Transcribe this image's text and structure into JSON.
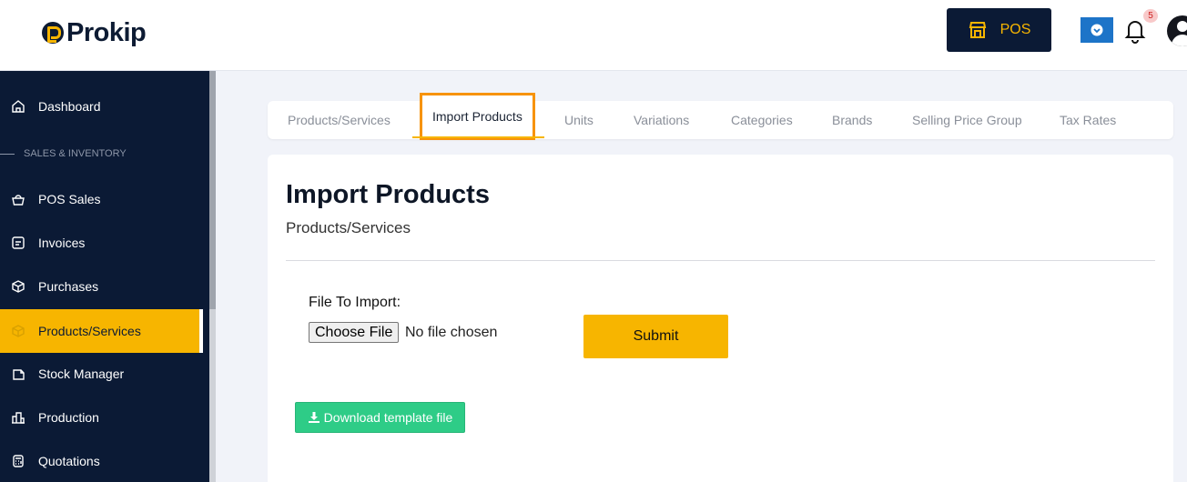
{
  "header": {
    "logo_text": "Prokip",
    "pos_label": "POS",
    "notification_count": "5"
  },
  "sidebar": {
    "section_label": "SALES & INVENTORY",
    "items": [
      {
        "label": "Dashboard",
        "icon": "home-icon"
      },
      {
        "label": "POS Sales",
        "icon": "basket-icon"
      },
      {
        "label": "Invoices",
        "icon": "invoice-icon"
      },
      {
        "label": "Purchases",
        "icon": "package-icon"
      },
      {
        "label": "Products/Services",
        "icon": "box-icon",
        "active": true
      },
      {
        "label": "Stock Manager",
        "icon": "stock-icon"
      },
      {
        "label": "Production",
        "icon": "factory-icon"
      },
      {
        "label": "Quotations",
        "icon": "calculator-icon"
      }
    ]
  },
  "tabs": [
    {
      "label": "Products/Services"
    },
    {
      "label": "Import Products",
      "active": true
    },
    {
      "label": "Units"
    },
    {
      "label": "Variations"
    },
    {
      "label": "Categories"
    },
    {
      "label": "Brands"
    },
    {
      "label": "Selling Price Group"
    },
    {
      "label": "Tax Rates"
    }
  ],
  "main": {
    "title": "Import Products",
    "subtitle": "Products/Services",
    "file_label": "File To Import:",
    "choose_file_label": "Choose File",
    "no_file_text": "No file chosen",
    "submit_label": "Submit",
    "download_template_label": "Download template file"
  },
  "colors": {
    "accent": "#f7b500",
    "sidebar_bg": "#0b1a35",
    "active_tab_border": "#f7930a",
    "template_button": "#2ecc87"
  }
}
